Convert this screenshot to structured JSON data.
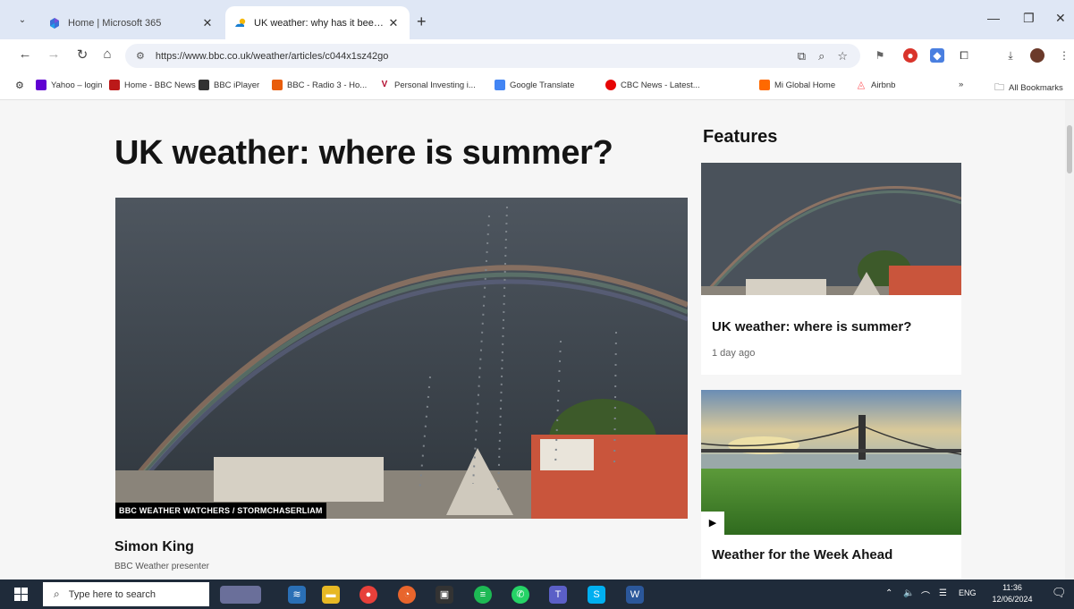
{
  "browser": {
    "tabs": [
      {
        "title": "Home | Microsoft 365",
        "active": false
      },
      {
        "title": "UK weather: why has it been so",
        "active": true
      }
    ],
    "url": "https://www.bbc.co.uk/weather/articles/c044x1sz42go",
    "bookmarks": [
      {
        "label": "Yahoo – login",
        "color": "#6001d2"
      },
      {
        "label": "Home - BBC News",
        "color": "#bb1919"
      },
      {
        "label": "BBC iPlayer",
        "color": "#333333"
      },
      {
        "label": "BBC - Radio 3 - Ho...",
        "color": "#e85d0c"
      },
      {
        "label": "Personal Investing i...",
        "color": "#b20c2e"
      },
      {
        "label": "Google Translate",
        "color": "#4285f4"
      },
      {
        "label": "CBC News - Latest...",
        "color": "#e60505"
      },
      {
        "label": "Mi Global Home",
        "color": "#ff6900"
      },
      {
        "label": "Airbnb",
        "color": "#ff5a5f"
      }
    ],
    "overflow": "»",
    "all_bookmarks": "All Bookmarks"
  },
  "article": {
    "headline": "UK weather: where is summer?",
    "image_caption": "BBC WEATHER WATCHERS / STORMCHASERLIAM",
    "author_name": "Simon King",
    "author_role": "BBC Weather presenter"
  },
  "features": {
    "heading": "Features",
    "cards": [
      {
        "title": "UK weather: where is summer?",
        "time": "1 day ago",
        "image": "rainbow-photo"
      },
      {
        "title": "Weather for the Week Ahead",
        "image": "bridge-photo",
        "is_video": true
      }
    ]
  },
  "taskbar": {
    "search_placeholder": "Type here to search",
    "language": "ENG",
    "time": "11:36",
    "date": "12/06/2024"
  },
  "colors": {
    "tab_strip": "#dfe7f5",
    "omnibox": "#eef1f8",
    "page_bg": "#f6f6f6",
    "taskbar": "#1f2b3a"
  }
}
